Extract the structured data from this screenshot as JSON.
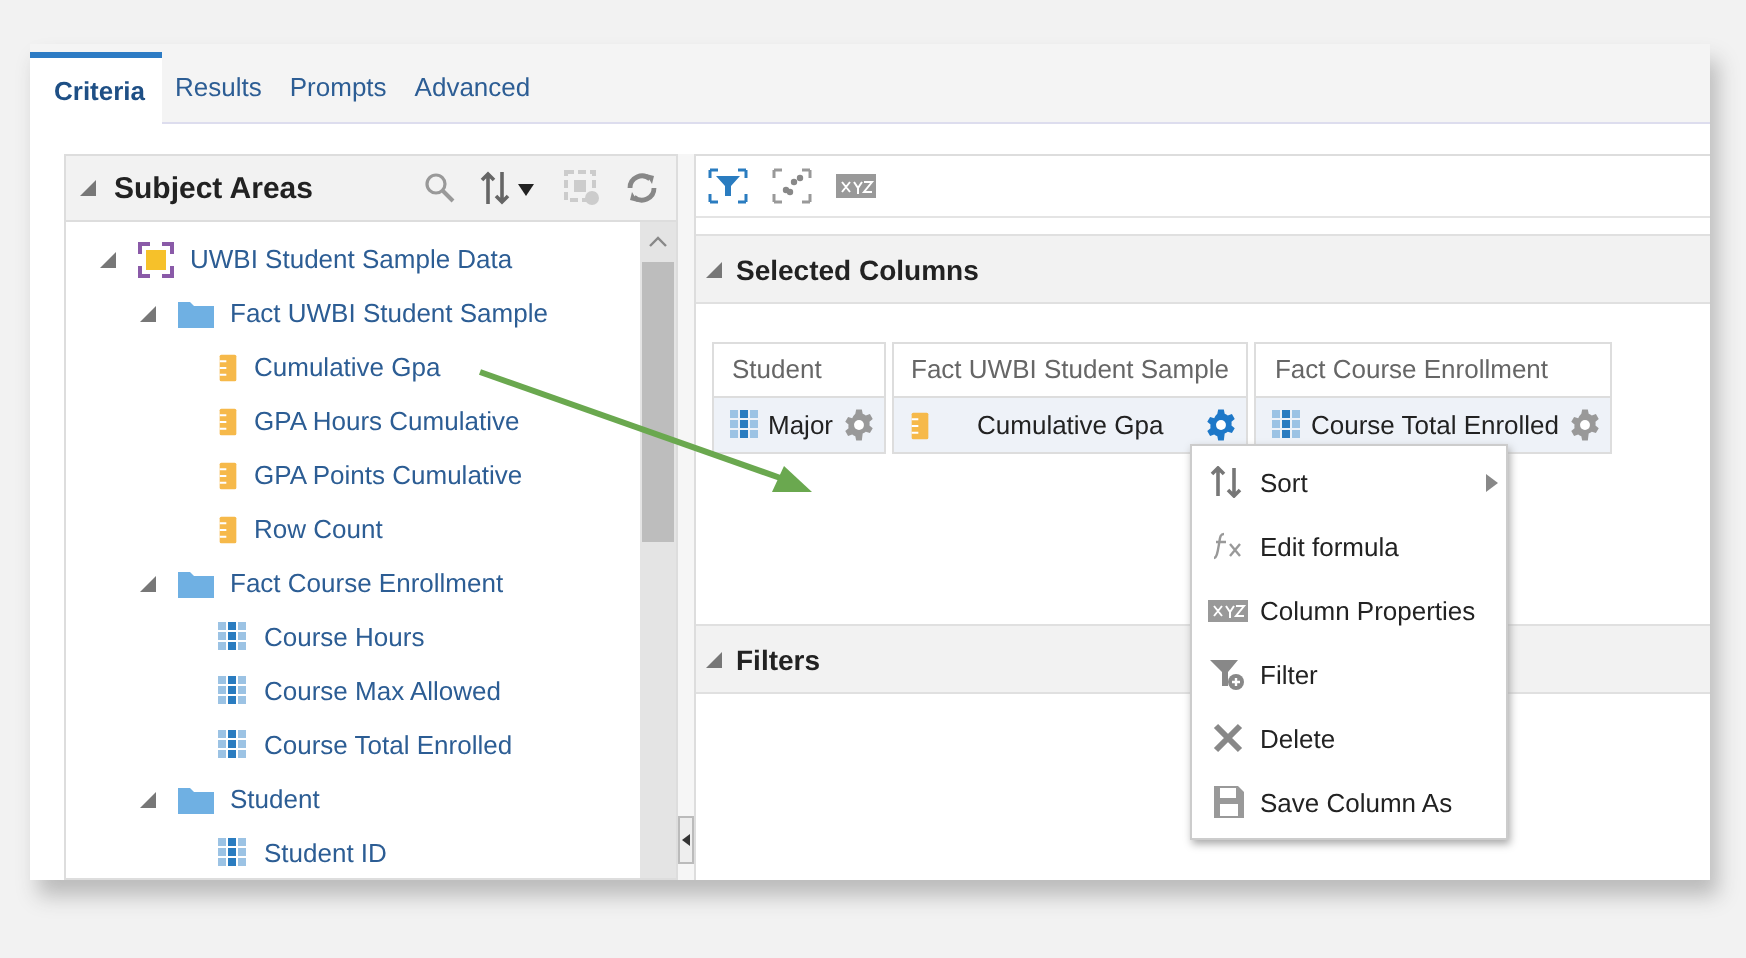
{
  "tabs": [
    {
      "label": "Criteria",
      "selected": true
    },
    {
      "label": "Results",
      "selected": false
    },
    {
      "label": "Prompts",
      "selected": false
    },
    {
      "label": "Advanced",
      "selected": false
    }
  ],
  "subject_areas": {
    "title": "Subject Areas",
    "expanded": true,
    "tree": [
      {
        "label": "UWBI Student Sample Data",
        "kind": "subject",
        "expanded": true,
        "children": [
          {
            "label": "Fact UWBI Student Sample",
            "kind": "folder",
            "expanded": true,
            "children": [
              {
                "label": "Cumulative Gpa",
                "kind": "measure"
              },
              {
                "label": "GPA Hours Cumulative",
                "kind": "measure"
              },
              {
                "label": "GPA Points Cumulative",
                "kind": "measure"
              },
              {
                "label": "Row Count",
                "kind": "measure"
              }
            ]
          },
          {
            "label": "Fact Course Enrollment",
            "kind": "folder",
            "expanded": true,
            "children": [
              {
                "label": "Course Hours",
                "kind": "attribute"
              },
              {
                "label": "Course Max Allowed",
                "kind": "attribute"
              },
              {
                "label": "Course Total Enrolled",
                "kind": "attribute"
              }
            ]
          },
          {
            "label": "Student",
            "kind": "folder",
            "expanded": true,
            "children": [
              {
                "label": "Student ID",
                "kind": "attribute"
              }
            ]
          }
        ]
      }
    ]
  },
  "selected_columns": {
    "title": "Selected Columns",
    "expanded": true,
    "columns": [
      {
        "group": "Student",
        "label": "Major",
        "kind": "attribute",
        "active": false
      },
      {
        "group": "Fact UWBI Student Sample",
        "label": "Cumulative Gpa",
        "kind": "measure",
        "active": true
      },
      {
        "group": "Fact Course Enrollment",
        "label": "Course Total Enrolled",
        "kind": "attribute",
        "active": false
      }
    ]
  },
  "filters": {
    "title": "Filters",
    "expanded": true
  },
  "context_menu": [
    {
      "label": "Sort",
      "kind": "sort",
      "submenu": true
    },
    {
      "label": "Edit formula",
      "kind": "formula",
      "submenu": false
    },
    {
      "label": "Column Properties",
      "kind": "properties",
      "submenu": false
    },
    {
      "label": "Filter",
      "kind": "filter",
      "submenu": false
    },
    {
      "label": "Delete",
      "kind": "delete",
      "submenu": false
    },
    {
      "label": "Save Column As",
      "kind": "save",
      "submenu": false
    }
  ]
}
